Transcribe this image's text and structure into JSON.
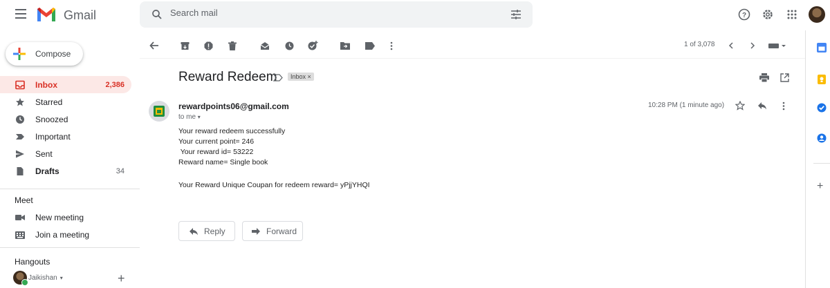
{
  "app": {
    "name": "Gmail"
  },
  "search": {
    "placeholder": "Search mail"
  },
  "sidebar": {
    "compose_label": "Compose",
    "items": [
      {
        "label": "Inbox",
        "count": "2,386"
      },
      {
        "label": "Starred",
        "count": ""
      },
      {
        "label": "Snoozed",
        "count": ""
      },
      {
        "label": "Important",
        "count": ""
      },
      {
        "label": "Sent",
        "count": ""
      },
      {
        "label": "Drafts",
        "count": "34"
      }
    ],
    "meet": {
      "title": "Meet",
      "new_meeting": "New meeting",
      "join_meeting": "Join a meeting"
    },
    "hangouts": {
      "title": "Hangouts",
      "user": "Jaikishan"
    }
  },
  "toolbar": {
    "pager": "1 of 3,078"
  },
  "email": {
    "subject": "Reward Redeem",
    "label_chip": "Inbox ×",
    "sender": "rewardpoints06@gmail.com",
    "to": "to me",
    "timestamp": "10:28 PM (1 minute ago)",
    "body": [
      "Your reward redeem successfully",
      "Your current point= 246",
      " Your reward id= 53222",
      "Reward name= Single book",
      "Your Reward Unique Coupan for redeem reward= yPjjYHQI"
    ],
    "reply_label": "Reply",
    "forward_label": "Forward"
  },
  "colors": {
    "accent_red": "#d93025",
    "active_bg": "#fce8e6",
    "icon_gray": "#5f6368"
  }
}
